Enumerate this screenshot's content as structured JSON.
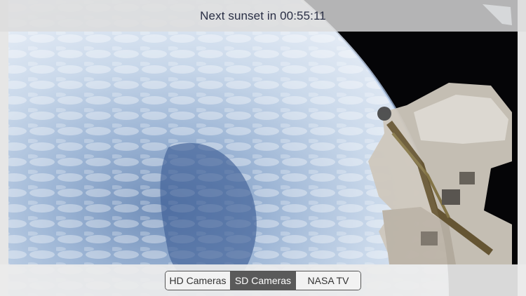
{
  "top_bar": {
    "sunset_countdown": "Next sunset in 00:55:11"
  },
  "camera_selector": {
    "options": [
      {
        "label": "HD Cameras",
        "selected": false
      },
      {
        "label": "SD Cameras",
        "selected": true
      },
      {
        "label": "NASA TV",
        "selected": false
      }
    ]
  },
  "colors": {
    "selected_segment": "#5a5a5a",
    "bar_background": "#dcdcdc"
  }
}
